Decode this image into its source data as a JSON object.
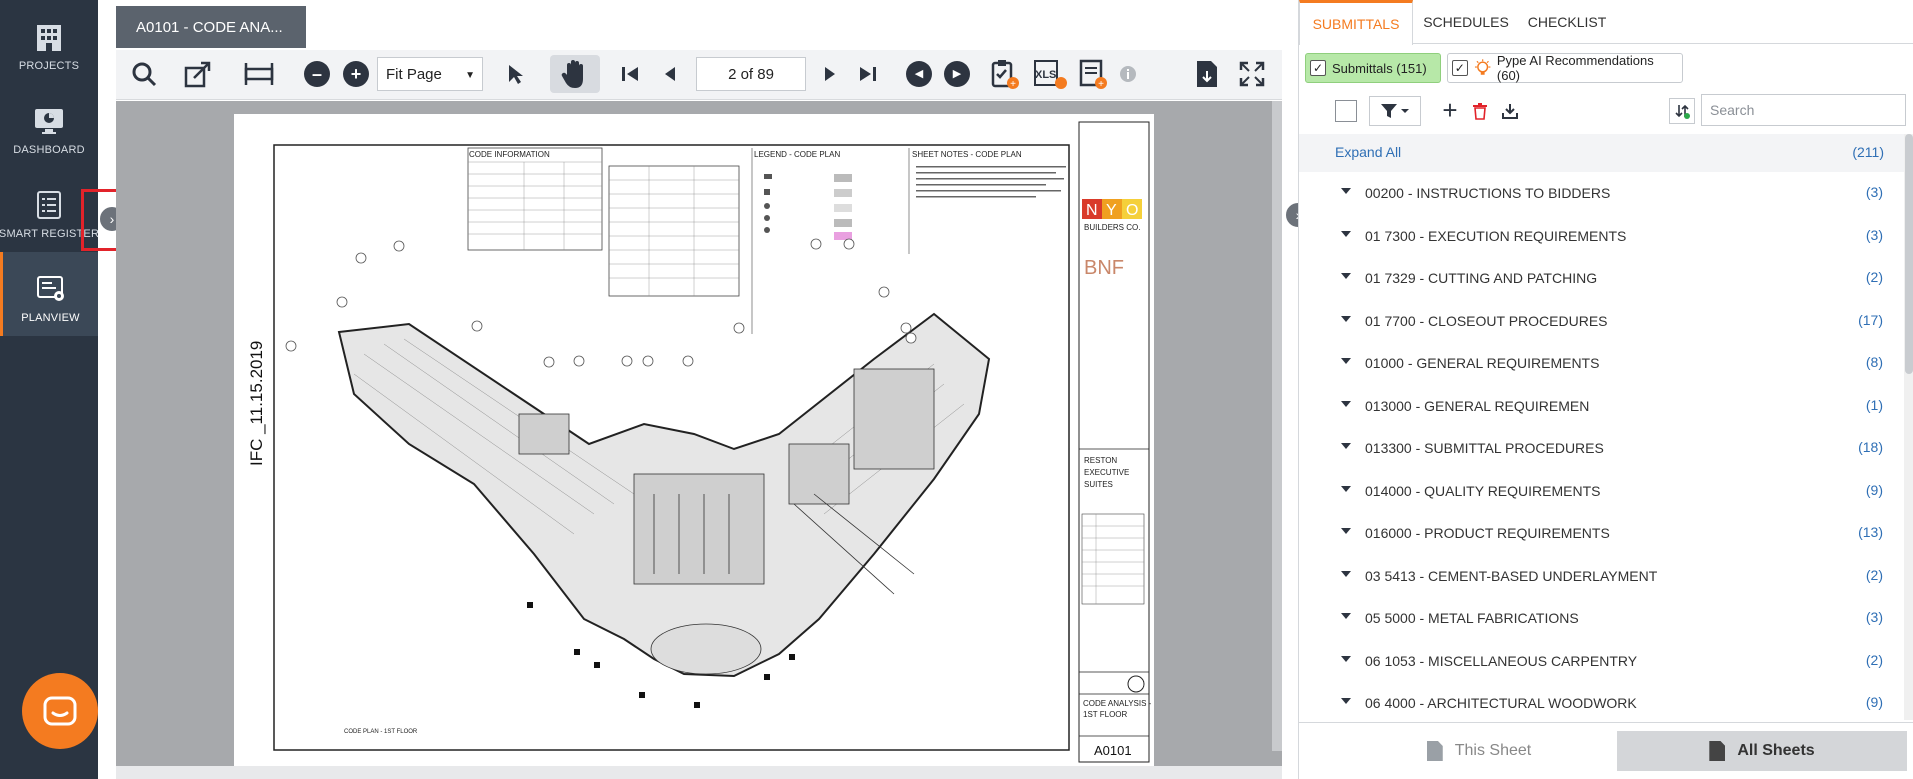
{
  "nav": {
    "items": [
      {
        "label": "PROJECTS",
        "icon": "building-icon"
      },
      {
        "label": "DASHBOARD",
        "icon": "monitor-icon"
      },
      {
        "label": "SMART REGISTER",
        "icon": "register-list-icon"
      },
      {
        "label": "PLANVIEW",
        "icon": "planview-icon"
      }
    ],
    "active": "PLANVIEW"
  },
  "viewer": {
    "doc_tab": "A0101 - CODE ANA...",
    "zoom_select": "Fit Page",
    "page_indicator": "2 of 89"
  },
  "sheet": {
    "stamp": "IFC _11.15.2019",
    "code_info_title": "CODE INFORMATION",
    "legend_title": "LEGEND - CODE PLAN",
    "notes_title": "SHEET NOTES - CODE PLAN",
    "logo_letters": [
      "N",
      "Y",
      "O"
    ],
    "logo_sub": "BUILDERS CO.",
    "arch_logo": "BNF",
    "project_name": [
      "RESTON",
      "EXECUTIVE",
      "SUITES"
    ],
    "sheet_title": [
      "CODE ANALYSIS -",
      "1ST FLOOR"
    ],
    "sheet_number": "A0101",
    "plan_caption": "CODE PLAN - 1ST FLOOR"
  },
  "panel": {
    "tabs": [
      "SUBMITTALS",
      "SCHEDULES",
      "CHECKLIST"
    ],
    "active_tab": "SUBMITTALS",
    "chip_submittals": "Submittals (151)",
    "chip_ai": "Pype AI Recommendations (60)",
    "search_placeholder": "Search",
    "expand_all": "Expand All",
    "total": "(211)",
    "rows": [
      {
        "name": "00200 - INSTRUCTIONS TO BIDDERS",
        "count": "(3)"
      },
      {
        "name": "01 7300 - EXECUTION REQUIREMENTS",
        "count": "(3)"
      },
      {
        "name": "01 7329 - CUTTING AND PATCHING",
        "count": "(2)"
      },
      {
        "name": "01 7700 - CLOSEOUT PROCEDURES",
        "count": "(17)"
      },
      {
        "name": "01000 - GENERAL REQUIREMENTS",
        "count": "(8)"
      },
      {
        "name": "013000 - GENERAL REQUIREMEN",
        "count": "(1)"
      },
      {
        "name": "013300 - SUBMITTAL PROCEDURES",
        "count": "(18)"
      },
      {
        "name": "014000 - QUALITY REQUIREMENTS",
        "count": "(9)"
      },
      {
        "name": "016000 - PRODUCT REQUIREMENTS",
        "count": "(13)"
      },
      {
        "name": "03 5413 - CEMENT-BASED UNDERLAYMENT",
        "count": "(2)"
      },
      {
        "name": "05 5000 - METAL FABRICATIONS",
        "count": "(3)"
      },
      {
        "name": "06 1053 - MISCELLANEOUS CARPENTRY",
        "count": "(2)"
      },
      {
        "name": "06 4000 - ARCHITECTURAL WOODWORK",
        "count": "(9)"
      }
    ],
    "bottom_this_sheet": "This Sheet",
    "bottom_all_sheets": "All Sheets"
  },
  "colors": {
    "accent": "#f47b20",
    "nav_bg": "#2b3542",
    "link": "#2f6fb5",
    "highlight": "#e2232a"
  }
}
